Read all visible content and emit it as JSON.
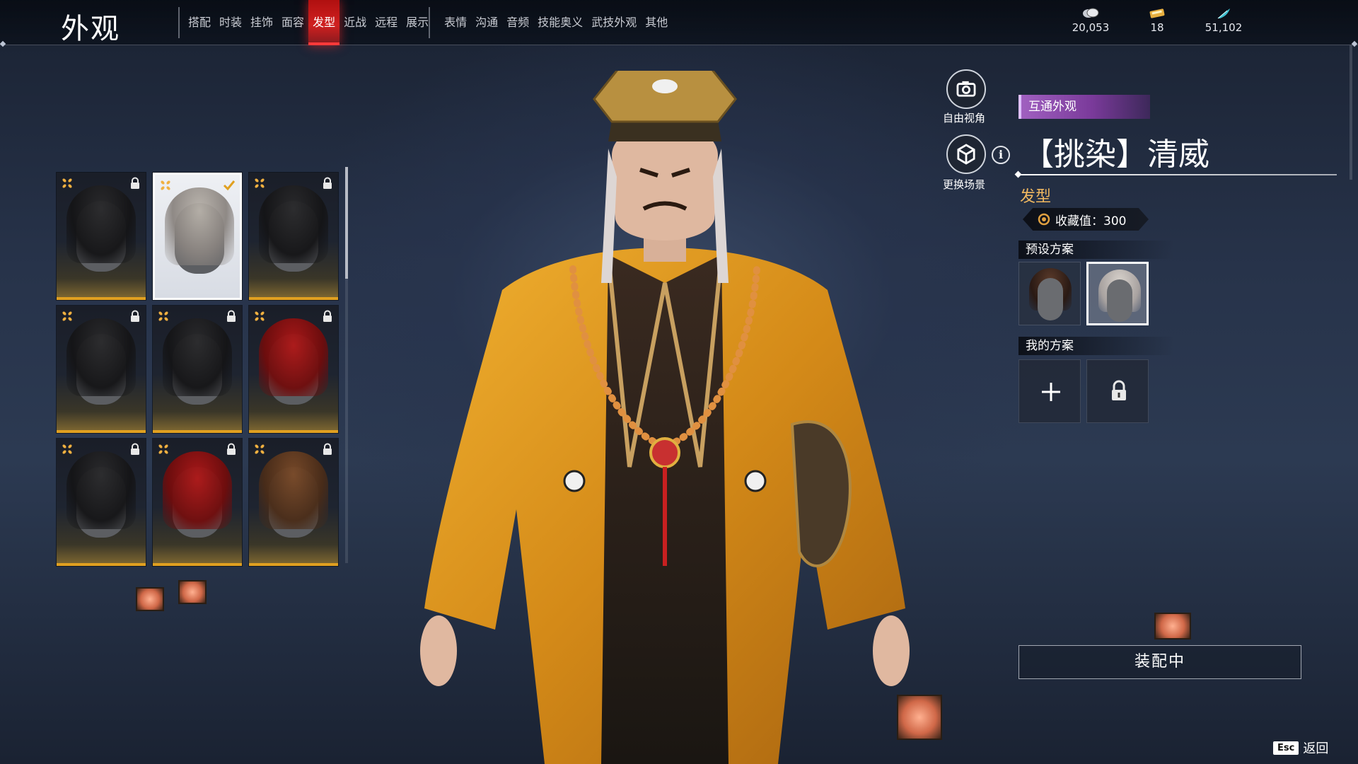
{
  "header": {
    "title": "外观",
    "tabs": [
      {
        "label": "搭配",
        "active": false
      },
      {
        "label": "时装",
        "active": false
      },
      {
        "label": "挂饰",
        "active": false
      },
      {
        "label": "面容",
        "active": false
      },
      {
        "label": "发型",
        "active": true
      },
      {
        "label": "近战",
        "active": false
      },
      {
        "label": "远程",
        "active": false
      },
      {
        "label": "展示",
        "active": false
      },
      {
        "label": "表情",
        "active": false
      },
      {
        "label": "沟通",
        "active": false
      },
      {
        "label": "音频",
        "active": false
      },
      {
        "label": "技能奥义",
        "active": false
      },
      {
        "label": "武技外观",
        "active": false
      },
      {
        "label": "其他",
        "active": false
      }
    ],
    "currencies": [
      {
        "icon": "coin-stack-icon",
        "value": "20,053"
      },
      {
        "icon": "ticket-icon",
        "value": "18"
      },
      {
        "icon": "feather-icon",
        "value": "51,102"
      }
    ]
  },
  "hair_grid": [
    {
      "hair": "dark",
      "locked": true,
      "selected": false
    },
    {
      "hair": "grey",
      "locked": false,
      "selected": true
    },
    {
      "hair": "dark",
      "locked": true,
      "selected": false
    },
    {
      "hair": "dark",
      "locked": true,
      "selected": false
    },
    {
      "hair": "dark",
      "locked": true,
      "selected": false
    },
    {
      "hair": "red",
      "locked": true,
      "selected": false
    },
    {
      "hair": "dark",
      "locked": true,
      "selected": false
    },
    {
      "hair": "red",
      "locked": true,
      "selected": false
    },
    {
      "hair": "brown",
      "locked": true,
      "selected": false
    }
  ],
  "view_controls": {
    "free_camera_label": "自由视角",
    "change_scene_label": "更换场景"
  },
  "detail": {
    "shared_badge": "互通外观",
    "item_name": "【挑染】清威",
    "category": "发型",
    "collect_value": "收藏值：300",
    "preset_header": "预设方案",
    "my_plans_header": "我的方案",
    "equip_button": "装配中"
  },
  "footer": {
    "esc_key": "Esc",
    "back_label": "返回"
  },
  "colors": {
    "accent_red": "#d02020",
    "gold": "#e0a020",
    "category_orange": "#f0b860",
    "shared_purple": "#a060c0"
  }
}
